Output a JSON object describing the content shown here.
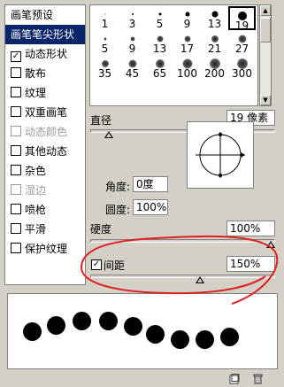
{
  "left_panel": {
    "items": [
      {
        "label": "画笔预设",
        "checkbox": false,
        "checked": false,
        "selected": false,
        "disabled": false
      },
      {
        "label": "画笔笔尖形状",
        "checkbox": false,
        "checked": false,
        "selected": true,
        "disabled": false
      },
      {
        "label": "动态形状",
        "checkbox": true,
        "checked": true,
        "selected": false,
        "disabled": false
      },
      {
        "label": "散布",
        "checkbox": true,
        "checked": false,
        "selected": false,
        "disabled": false
      },
      {
        "label": "纹理",
        "checkbox": true,
        "checked": false,
        "selected": false,
        "disabled": false
      },
      {
        "label": "双重画笔",
        "checkbox": true,
        "checked": false,
        "selected": false,
        "disabled": false
      },
      {
        "label": "动态颜色",
        "checkbox": true,
        "checked": false,
        "selected": false,
        "disabled": true
      },
      {
        "label": "其他动态",
        "checkbox": true,
        "checked": false,
        "selected": false,
        "disabled": false
      },
      {
        "label": "杂色",
        "checkbox": true,
        "checked": false,
        "selected": false,
        "disabled": false
      },
      {
        "label": "湿边",
        "checkbox": true,
        "checked": false,
        "selected": false,
        "disabled": true
      },
      {
        "label": "喷枪",
        "checkbox": true,
        "checked": false,
        "selected": false,
        "disabled": false
      },
      {
        "label": "平滑",
        "checkbox": true,
        "checked": false,
        "selected": false,
        "disabled": false
      },
      {
        "label": "保护纹理",
        "checkbox": true,
        "checked": false,
        "selected": false,
        "disabled": false
      }
    ],
    "check_mark": "✓"
  },
  "brush_presets": {
    "rows": [
      [
        {
          "size": "1",
          "hard": true
        },
        {
          "size": "3",
          "hard": true
        },
        {
          "size": "5",
          "hard": true
        },
        {
          "size": "9",
          "hard": true
        },
        {
          "size": "13",
          "hard": true
        },
        {
          "size": "19",
          "hard": true,
          "selected": true
        }
      ],
      [
        {
          "size": "5",
          "hard": false
        },
        {
          "size": "9",
          "hard": false
        },
        {
          "size": "13",
          "hard": false
        },
        {
          "size": "17",
          "hard": false
        },
        {
          "size": "21",
          "hard": false
        },
        {
          "size": "27",
          "hard": false
        }
      ],
      [
        {
          "size": "35",
          "hard": false
        },
        {
          "size": "45",
          "hard": false
        },
        {
          "size": "65",
          "hard": false
        },
        {
          "size": "100",
          "hard": false
        },
        {
          "size": "200",
          "hard": false
        },
        {
          "size": "300",
          "hard": false
        }
      ]
    ]
  },
  "diameter": {
    "label": "直径",
    "value": "19 像素",
    "slider_fraction": 0.08
  },
  "angle": {
    "label": "角度:",
    "value": "0度"
  },
  "roundness": {
    "label": "圆度:",
    "value": "100%"
  },
  "hardness": {
    "label": "硬度",
    "value": "100%",
    "slider_fraction": 1.0
  },
  "spacing": {
    "label": "间距",
    "value": "150%",
    "checked": true,
    "check_mark": "✓",
    "slider_fraction": 0.6
  },
  "colors": {
    "selection": "#0a246a",
    "annotation": "#e02020",
    "panel": "#d4d0c8"
  },
  "bottom_icons": [
    "new-preset-icon",
    "trash-icon"
  ]
}
